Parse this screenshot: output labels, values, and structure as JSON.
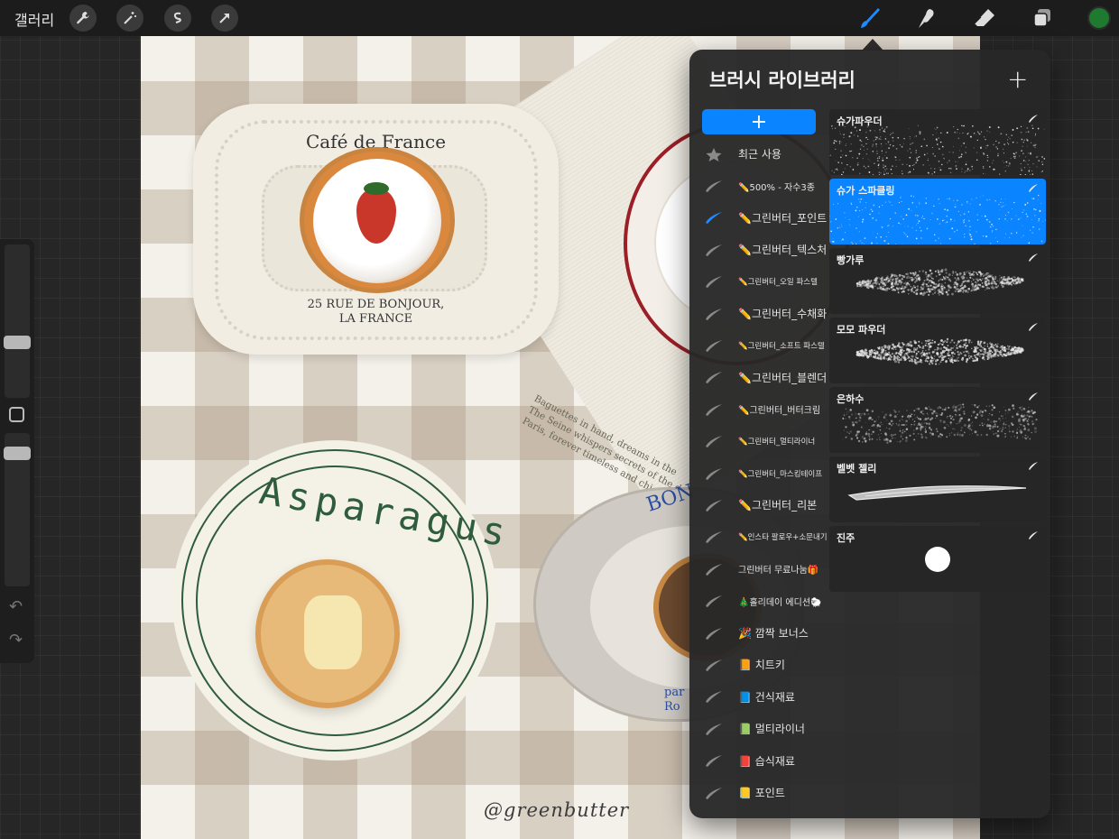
{
  "toolbar": {
    "gallery_label": "갤러리",
    "left_tools": [
      "wrench-icon",
      "magic-wand-icon",
      "selection-icon",
      "transform-arrow-icon"
    ],
    "right_tools": [
      "brush-icon",
      "smudge-icon",
      "eraser-icon",
      "layers-icon"
    ],
    "active_tool": "brush-icon",
    "current_color": "#1e7a2e"
  },
  "sidebar": {
    "size_slider_level": 0.35,
    "opacity_slider_level": 0.9
  },
  "canvas": {
    "cafe_title": "Café de France",
    "cafe_address_line1": "25 RUE DE BONJOUR,",
    "cafe_address_line2": "LA FRANCE",
    "baguette_line1": "Baguettes in hand, dreams in the",
    "baguette_line2": "The Seine whispers secrets of the d",
    "baguette_line3": "Paris, forever timeless and chic.",
    "asparagus_label": "Asparagus",
    "bon_text": "BON",
    "par_text_line1": "par",
    "par_text_line2": "Ro",
    "signature": "@greenbutter"
  },
  "brush_library": {
    "title": "브러시 라이브러리",
    "add_label": "+",
    "new_set_label": "+",
    "sets": [
      {
        "label": "최근 사용",
        "icon": "star-icon",
        "size": "md"
      },
      {
        "label": "500% - 자수3종",
        "icon": "brush-stroke-icon",
        "size": "sm",
        "emoji": "✏️"
      },
      {
        "label": "그린버터_포인트",
        "icon": "brush-stroke-icon-active",
        "size": "md",
        "emoji": "✏️"
      },
      {
        "label": "그린버터_텍스처",
        "icon": "brush-stroke-icon",
        "size": "md",
        "emoji": "✏️"
      },
      {
        "label": "그린버터_오일 파스텔",
        "icon": "brush-stroke-icon",
        "size": "xs",
        "emoji": "✏️"
      },
      {
        "label": "그린버터_수채화",
        "icon": "brush-stroke-icon",
        "size": "md",
        "emoji": "✏️"
      },
      {
        "label": "그린버터_소프트 파스텔",
        "icon": "brush-stroke-icon",
        "size": "xs",
        "emoji": "✏️"
      },
      {
        "label": "그린버터_블렌더",
        "icon": "brush-stroke-icon",
        "size": "md",
        "emoji": "✏️"
      },
      {
        "label": "그린버터_버터크림",
        "icon": "brush-stroke-icon",
        "size": "sm",
        "emoji": "✏️"
      },
      {
        "label": "그린버터_멀티라이너",
        "icon": "brush-stroke-icon",
        "size": "xs",
        "emoji": "✏️"
      },
      {
        "label": "그린버터_마스킹테이프",
        "icon": "brush-stroke-icon",
        "size": "xs",
        "emoji": "✏️"
      },
      {
        "label": "그린버터_리본",
        "icon": "brush-stroke-icon",
        "size": "md",
        "emoji": "✏️"
      },
      {
        "label": "인스타 팔로우+소문내기",
        "icon": "brush-stroke-icon",
        "size": "xs",
        "emoji": "✏️"
      },
      {
        "label": "그린버터 무료나눔🎁",
        "icon": "brush-stroke-icon",
        "size": "sm",
        "emoji": ""
      },
      {
        "label": "🎄홀리데이 에디션🐑",
        "icon": "brush-stroke-icon",
        "size": "sm",
        "emoji": ""
      },
      {
        "label": "🎉 깜짝 보너스",
        "icon": "brush-stroke-icon",
        "size": "md",
        "emoji": ""
      },
      {
        "label": "📙 치트키",
        "icon": "brush-stroke-icon",
        "size": "md",
        "emoji": ""
      },
      {
        "label": "📘 건식재료",
        "icon": "brush-stroke-icon",
        "size": "md",
        "emoji": ""
      },
      {
        "label": "📗 멀티라이너",
        "icon": "brush-stroke-icon",
        "size": "md",
        "emoji": ""
      },
      {
        "label": "📕 습식재료",
        "icon": "brush-stroke-icon",
        "size": "md",
        "emoji": ""
      },
      {
        "label": "📒 포인트",
        "icon": "brush-stroke-icon",
        "size": "md",
        "emoji": ""
      }
    ],
    "active_set_index": 2,
    "brushes": [
      {
        "name": "슈가파우더",
        "preview": "fine-speckle"
      },
      {
        "name": "슈가 스파클링",
        "preview": "sparkle"
      },
      {
        "name": "빵가루",
        "preview": "grainy-stroke"
      },
      {
        "name": "모모 파우더",
        "preview": "soft-stroke"
      },
      {
        "name": "은하수",
        "preview": "galaxy"
      },
      {
        "name": "벨벳 젤리",
        "preview": "jelly-line"
      },
      {
        "name": "진주",
        "preview": "pearl-dot"
      }
    ],
    "selected_brush_index": 1
  }
}
